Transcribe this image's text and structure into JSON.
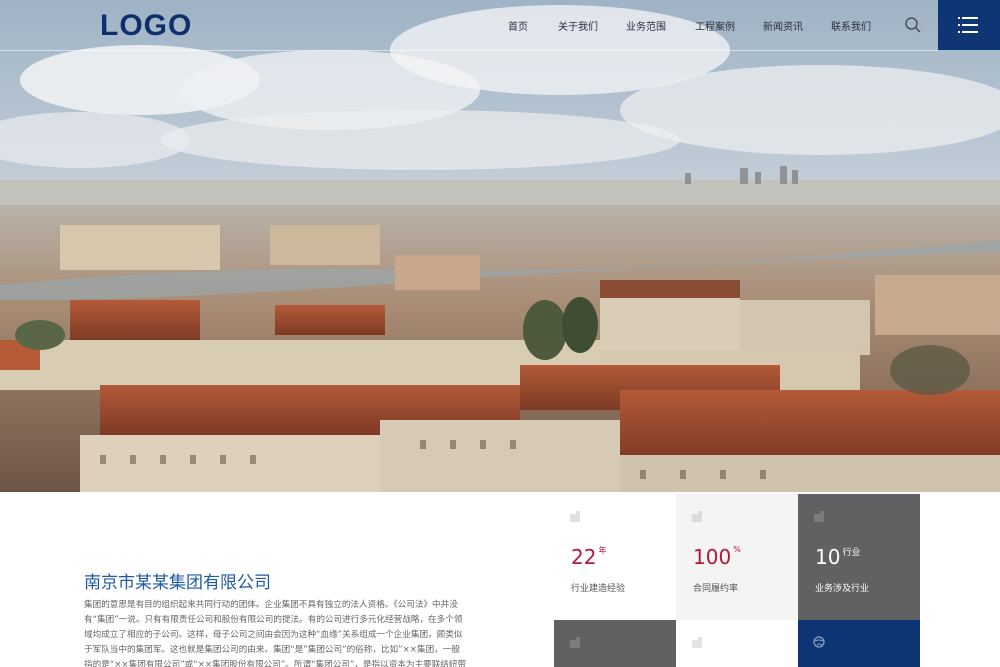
{
  "header": {
    "logo": "LOGO",
    "nav": [
      "首页",
      "关于我们",
      "业务范围",
      "工程案例",
      "新闻资讯",
      "联系我们"
    ]
  },
  "icons": {
    "search": "search-icon",
    "menu": "menu-icon",
    "tile": "building-icon",
    "globe": "globe-icon"
  },
  "intro": {
    "title": "南京市某某集团有限公司",
    "text": "集团的意思是有目的组织起来共同行动的团体。企业集团不具有独立的法人资格。《公司法》中并没有“集团”一说。只有有限责任公司和股份有限公司的提法。有的公司进行多元化经营战略，在多个领域均成立了相应的子公司。这样，母子公司之间由会因为这种“血缘”关系组成一个企业集团，颇类似于军队当中的集团军。这也就是集团公司的由来。集团“是”集团公司“的俗称，比如”××集团，一般指的是“××集团有限公司”或“××集团股份有限公司”。所谓“集团公司”，是指以资本为主要联结纽带的母子公司为主体"
  },
  "stats": [
    {
      "value": "22",
      "unit": "年",
      "label": "行业建造经验"
    },
    {
      "value": "100",
      "unit": "%",
      "label": "合同履约率"
    },
    {
      "value": "10",
      "unit": "行业",
      "label": "业务涉及行业"
    }
  ],
  "colors": {
    "brand": "#0e3574",
    "accent_red": "#b2183a",
    "tile_gray": "#5f6163",
    "tile_light": "#f4f4f4",
    "title_blue": "#1f5aa6"
  }
}
